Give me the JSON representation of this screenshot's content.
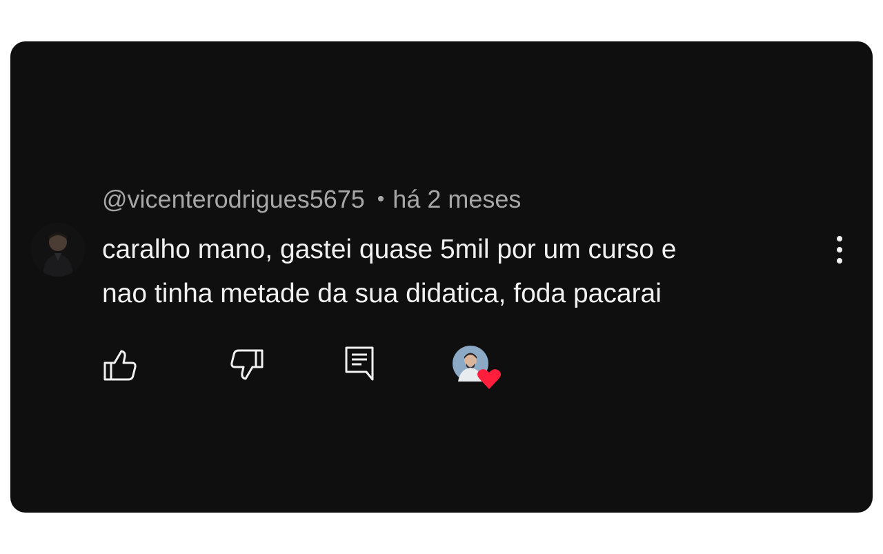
{
  "comment": {
    "author_handle": "@vicenterodrigues5675",
    "separator": "•",
    "time_ago": "há 2 meses",
    "text_lines": [
      "caralho mano, gastei quase 5mil por um curso e",
      "nao tinha metade da sua didatica, foda pacarai"
    ]
  },
  "icons": {
    "avatar": "user-avatar",
    "more": "more-vertical-icon",
    "like": "thumbs-up-icon",
    "dislike": "thumbs-down-icon",
    "reply": "comment-reply-icon",
    "creator_heart": "creator-heart-badge"
  },
  "colors": {
    "background": "#0f0f10",
    "text_primary": "#f1f1f1",
    "text_secondary": "#a7a7a7",
    "heart": "#ff1f3d",
    "icon": "#f1f1f1"
  }
}
